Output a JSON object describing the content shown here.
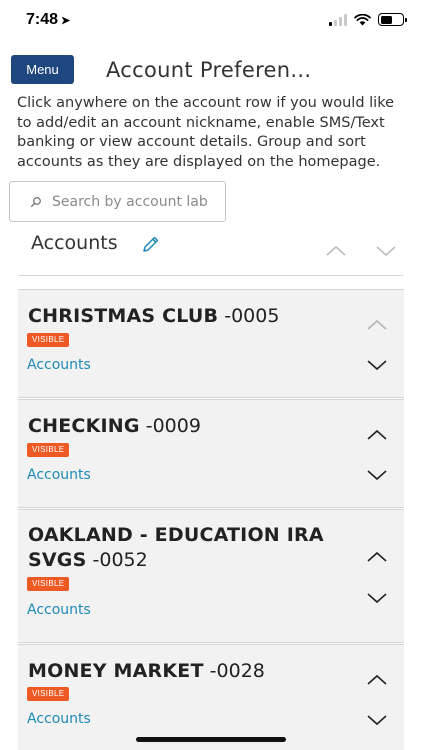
{
  "status_bar": {
    "time": "7:48",
    "location_glyph": "➤"
  },
  "header": {
    "menu_label": "Menu",
    "title": "Account Preferen..."
  },
  "intro_text": "Click anywhere on the account row if you would like to add/edit an account nickname, enable SMS/Text banking or view account details. Group and sort accounts as they are displayed on the homepage.",
  "search": {
    "placeholder": "Search by account lab"
  },
  "group": {
    "title": "Accounts"
  },
  "accounts": [
    {
      "name": "CHRISTMAS CLUB",
      "suffix": "-0005",
      "badge": "VISIBLE",
      "group_link": "Accounts"
    },
    {
      "name": "CHECKING",
      "suffix": "-0009",
      "badge": "VISIBLE",
      "group_link": "Accounts"
    },
    {
      "name": "OAKLAND - EDUCATION IRA SVGS",
      "suffix": "-0052",
      "badge": "VISIBLE",
      "group_link": "Accounts"
    },
    {
      "name": "MONEY MARKET",
      "suffix": "-0028",
      "badge": "VISIBLE",
      "group_link": "Accounts"
    }
  ],
  "colors": {
    "menu_button": "#1f477f",
    "badge": "#ee5a24",
    "link": "#1f8ab3",
    "card_bg": "#f2f2f2"
  }
}
